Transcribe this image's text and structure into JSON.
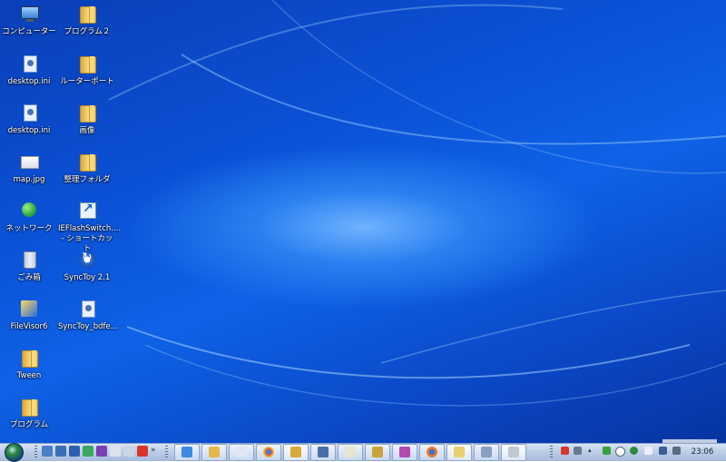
{
  "desktop": {
    "icons": [
      {
        "label": "コンピューター",
        "icon": "computer-icon"
      },
      {
        "label": "desktop.ini",
        "icon": "settings-file-icon"
      },
      {
        "label": "desktop.ini",
        "icon": "settings-file-icon"
      },
      {
        "label": "map.jpg",
        "icon": "image-file-icon"
      },
      {
        "label": "ネットワーク",
        "icon": "network-icon"
      },
      {
        "label": "ごみ箱",
        "icon": "recycle-bin-icon"
      },
      {
        "label": "FileVisor6",
        "icon": "filevisor-app-icon"
      },
      {
        "label": "Tween",
        "icon": "folder-icon"
      },
      {
        "label": "プログラム",
        "icon": "folder-icon"
      },
      {
        "label": "プログラム２",
        "icon": "folder-icon"
      },
      {
        "label": "ルーターポート",
        "icon": "folder-icon"
      },
      {
        "label": "画像",
        "icon": "folder-icon"
      },
      {
        "label": "整理フォルダ",
        "icon": "folder-icon"
      },
      {
        "label": "IEFlashSwitch.... - ショートカット",
        "icon": "shortcut-icon"
      },
      {
        "label": "SyncToy 2.1",
        "icon": "synctoy-icon"
      },
      {
        "label": "SyncToy_bdfe...",
        "icon": "text-file-icon"
      }
    ]
  },
  "taskbar": {
    "start_icon": "windows-start-orb-icon",
    "clock": "23:06"
  },
  "colors": {
    "desktop_dark": "#0634a0",
    "desktop_mid": "#0f62e6",
    "desktop_glow": "#6fb2ff",
    "taskbar": "#b9cbe6"
  }
}
